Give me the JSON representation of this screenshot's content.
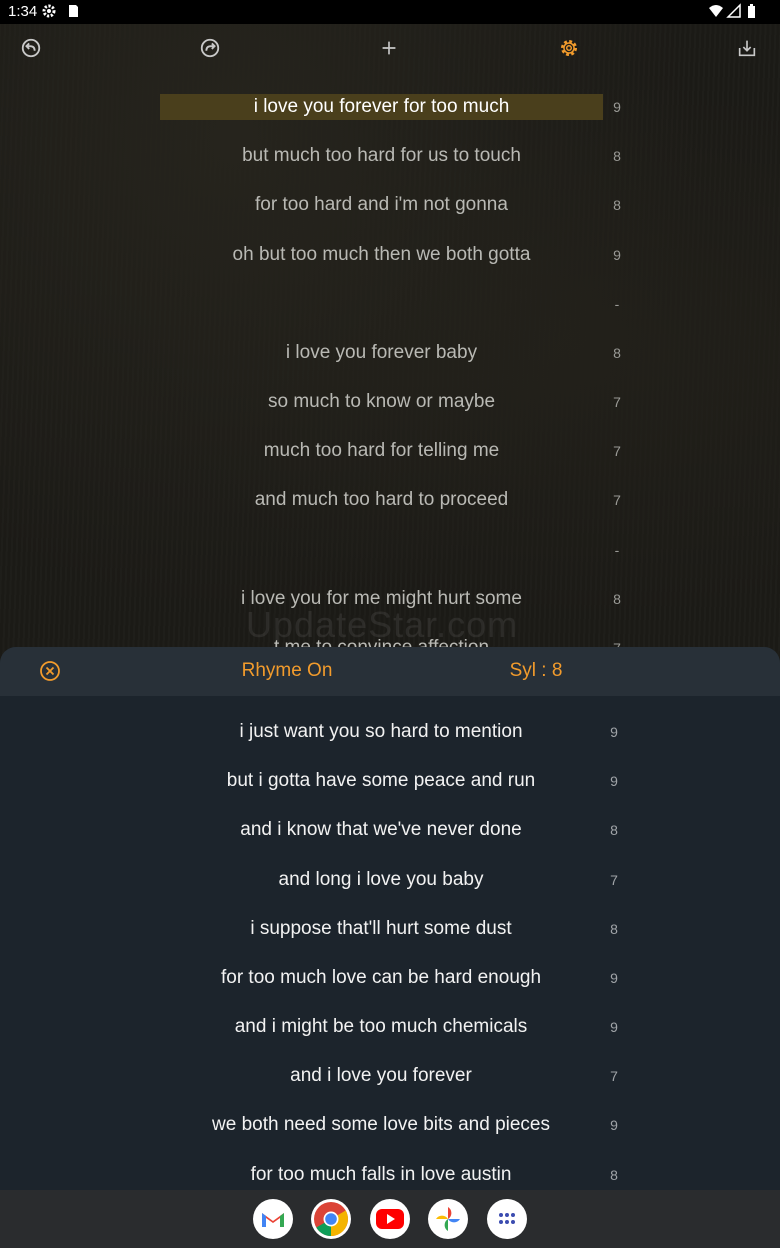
{
  "status_bar": {
    "time": "1:34"
  },
  "lyrics": [
    {
      "text": "i love you forever for too much",
      "count": "9",
      "active": true
    },
    {
      "text": "but much too hard for us to touch",
      "count": "8"
    },
    {
      "text": "for too hard and i'm not gonna",
      "count": "8"
    },
    {
      "text": "oh but too much then we both gotta",
      "count": "9"
    },
    {
      "text": "",
      "count": "-"
    },
    {
      "text": "i love you forever baby",
      "count": "8"
    },
    {
      "text": "so much to know or maybe",
      "count": "7"
    },
    {
      "text": "much too hard for telling me",
      "count": "7"
    },
    {
      "text": "and much too hard to proceed",
      "count": "7"
    },
    {
      "text": "",
      "count": "-"
    },
    {
      "text": "i love you for me might hurt some",
      "count": "8"
    },
    {
      "text": "t me to convince affection",
      "count": "7"
    }
  ],
  "watermark": "UpdateStar.com",
  "sheet": {
    "rhyme_toggle": "Rhyme On",
    "syllables": "Syl : 8",
    "suggestions": [
      {
        "text": "i just want you so hard to mention",
        "count": "9"
      },
      {
        "text": "but i gotta have some peace and run",
        "count": "9"
      },
      {
        "text": "and i know that we've never done",
        "count": "8"
      },
      {
        "text": "and long i love you baby",
        "count": "7"
      },
      {
        "text": "i suppose that'll hurt some dust",
        "count": "8"
      },
      {
        "text": "for too much love can be hard enough",
        "count": "9"
      },
      {
        "text": "and i might be too much chemicals",
        "count": "9"
      },
      {
        "text": "and i love you forever",
        "count": "7"
      },
      {
        "text": "we both need some love bits and pieces",
        "count": "9"
      },
      {
        "text": "for too much falls in love austin",
        "count": "8"
      }
    ]
  },
  "dock_apps": [
    "gmail-icon",
    "chrome-icon",
    "youtube-icon",
    "photos-icon",
    "app-drawer-icon"
  ],
  "colors": {
    "accent": "#f29b2c",
    "highlight": "#4a3f1c",
    "sheet_bg": "#1c242c",
    "sheet_header": "#283038"
  }
}
